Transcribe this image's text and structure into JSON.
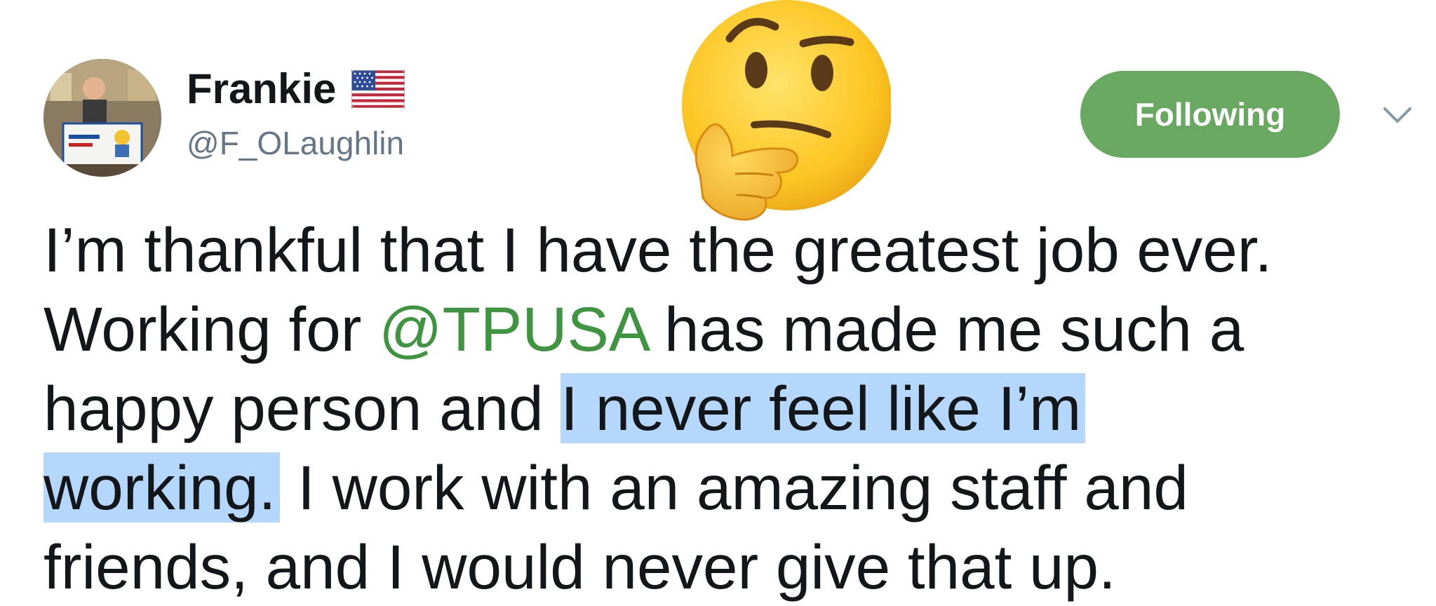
{
  "user": {
    "display_name": "Frankie",
    "handle": "@F_OLaughlin",
    "avatar_icon": "avatar-photo",
    "flag_icon": "us-flag-icon"
  },
  "follow_button": {
    "label": "Following",
    "color": "#68a860"
  },
  "menu": {
    "icon": "chevron-down-icon"
  },
  "overlay": {
    "emoji": "thinking-face-icon"
  },
  "tweet": {
    "line1": "I’m thankful that I have the greatest job ever.",
    "line2_prefix": "Working for ",
    "mention": "@TPUSA",
    "line2_suffix": " has made me such a",
    "line3_prefix": "happy person and ",
    "highlight_part1": "I never feel like I’m ",
    "highlight_part2": "working.",
    "line4_suffix": " I work with an amazing staff and",
    "line5": "friends, and I would never give that up."
  },
  "colors": {
    "text": "#14171a",
    "secondary_text": "#657786",
    "mention": "#3f9440",
    "highlight": "#b5d7fb"
  }
}
